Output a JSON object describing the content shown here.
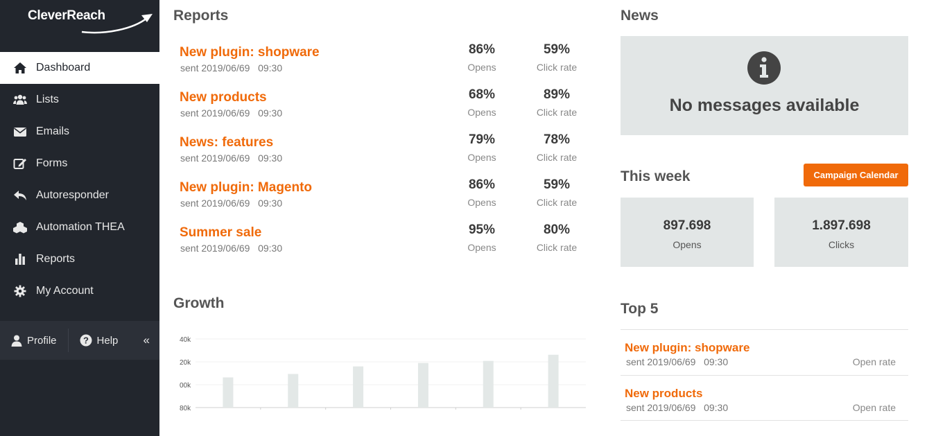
{
  "app": {
    "logo_text": "CleverReach"
  },
  "sidebar": {
    "items": [
      {
        "label": "Dashboard",
        "icon": "home-icon",
        "active": true
      },
      {
        "label": "Lists",
        "icon": "users-icon"
      },
      {
        "label": "Emails",
        "icon": "envelope-icon"
      },
      {
        "label": "Forms",
        "icon": "edit-icon"
      },
      {
        "label": "Autoresponder",
        "icon": "reply-icon"
      },
      {
        "label": "Automation THEA",
        "icon": "cubes-icon"
      },
      {
        "label": "Reports",
        "icon": "bar-chart-icon"
      },
      {
        "label": "My Account",
        "icon": "gear-icon"
      }
    ],
    "footer": {
      "profile": "Profile",
      "help": "Help",
      "collapse": "«"
    }
  },
  "reports": {
    "heading": "Reports",
    "rows": [
      {
        "title": "New plugin: shopware",
        "sent": "sent 2019/06/69   09:30",
        "opens": "86%",
        "opens_label": "Opens",
        "click": "59%",
        "click_label": "Click rate"
      },
      {
        "title": "New products",
        "sent": "sent 2019/06/69   09:30",
        "opens": "68%",
        "opens_label": "Opens",
        "click": "89%",
        "click_label": "Click rate"
      },
      {
        "title": "News: features",
        "sent": "sent 2019/06/69   09:30",
        "opens": "79%",
        "opens_label": "Opens",
        "click": "78%",
        "click_label": "Click rate"
      },
      {
        "title": "New plugin: Magento",
        "sent": "sent 2019/06/69   09:30",
        "opens": "86%",
        "opens_label": "Opens",
        "click": "59%",
        "click_label": "Click rate"
      },
      {
        "title": "Summer sale",
        "sent": "sent 2019/06/69   09:30",
        "opens": "95%",
        "opens_label": "Opens",
        "click": "80%",
        "click_label": "Click rate"
      }
    ]
  },
  "growth": {
    "heading": "Growth"
  },
  "chart_data": {
    "type": "bar",
    "yticks": [
      "40k",
      "20k",
      "00k",
      "80k"
    ],
    "values": [
      0.44,
      0.49,
      0.6,
      0.65,
      0.68,
      0.77
    ],
    "color": "#e3e8e7"
  },
  "news": {
    "heading": "News",
    "message": "No messages available",
    "icon": "info-icon"
  },
  "this_week": {
    "heading": "This week",
    "calendar_button": "Campaign Calendar",
    "opens_value": "897.698",
    "opens_label": "Opens",
    "clicks_value": "1.897.698",
    "clicks_label": "Clicks"
  },
  "top5": {
    "heading": "Top 5",
    "items": [
      {
        "title": "New plugin: shopware",
        "sent": "sent 2019/06/69   09:30",
        "rate_label": "Open rate"
      },
      {
        "title": "New products",
        "sent": "sent 2019/06/69   09:30",
        "rate_label": "Open rate"
      }
    ]
  },
  "colors": {
    "accent": "#f06a0a",
    "sidebar": "#22262d",
    "panel": "#e2e6e6"
  }
}
